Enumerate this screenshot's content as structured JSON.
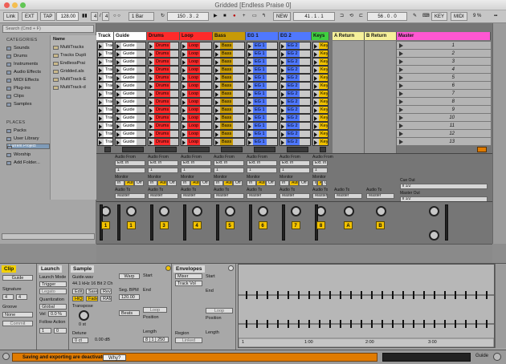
{
  "window": {
    "title": "Gridded  [Endless Praise 0]"
  },
  "control_bar": {
    "link": "Link",
    "ext": "EXT",
    "tap": "TAP",
    "tempo": "128.00",
    "signature_num": "4",
    "signature_den": "4",
    "metronome": "○ ○",
    "quantize": "1 Bar",
    "position": "150 .   3 .   2",
    "new": "NEW",
    "loop_start": "41 .   1 .   1",
    "loop_length": "56 .   0 .   0",
    "key": "KEY",
    "midi": "MIDI",
    "cpu": "9 %"
  },
  "browser": {
    "search_placeholder": "Search (Cmd + F)",
    "categories_header": "CATEGORIES",
    "categories": [
      "Sounds",
      "Drums",
      "Instruments",
      "Audio Effects",
      "MIDI Effects",
      "Plug-ins",
      "Clips",
      "Samples"
    ],
    "places_header": "PLACES",
    "places": [
      "Packs",
      "User Library",
      "Current Project",
      "Worship",
      "Add Folder..."
    ],
    "name_header": "Name",
    "files": [
      "MultiTracks",
      "Tracks Dupli",
      "EndlessPrai",
      "Gridded.als",
      "MultiTrack-E",
      "MultiTrack-d"
    ]
  },
  "tracks": [
    {
      "name": "Track",
      "color": "#ffffff",
      "clip": "Track",
      "clip_color": "#ffffff",
      "number": "1"
    },
    {
      "name": "Guide",
      "color": "#ffffff",
      "clip": "Guide",
      "clip_color": "#ffffff",
      "number": "1"
    },
    {
      "name": "Drums",
      "color": "#ff2a2a",
      "clip": "Drums",
      "clip_color": "#ff2a2a",
      "number": "3"
    },
    {
      "name": "Loop",
      "color": "#ff2a2a",
      "clip": "Loop",
      "clip_color": "#ff2a2a",
      "number": "4"
    },
    {
      "name": "Bass",
      "color": "#c79a06",
      "clip": "Bass",
      "clip_color": "#c79a06",
      "number": "5"
    },
    {
      "name": "EG 1",
      "color": "#4f78ff",
      "clip": "EG 1",
      "clip_color": "#4f78ff",
      "number": "6"
    },
    {
      "name": "EG 2",
      "color": "#4f78ff",
      "clip": "EG 2",
      "clip_color": "#4f78ff",
      "number": "7"
    },
    {
      "name": "Keys",
      "color": "#3fcf3f",
      "clip": "Key",
      "clip_color": "#f0c100",
      "number": "8"
    }
  ],
  "returns": [
    {
      "name": "A Return",
      "color": "#f6f09a",
      "letter": "A"
    },
    {
      "name": "B Return",
      "color": "#f6f09a",
      "letter": "B"
    }
  ],
  "master": {
    "name": "Master",
    "color": "#ff57d2",
    "scenes": [
      "1",
      "2",
      "3",
      "4",
      "5",
      "6",
      "7",
      "8",
      "9",
      "10",
      "11",
      "12",
      "13"
    ],
    "cue_out_label": "Cue Out",
    "cue_out": "ii 1/2",
    "master_out_label": "Master Out",
    "master_out": "ii 1/2"
  },
  "io": {
    "audio_from": "Audio From",
    "ext_in": "Ext. In",
    "in_1": "1",
    "monitor": "Monitor",
    "in": "In",
    "auto": "Auto",
    "off": "Off",
    "audio_to": "Audio To",
    "master": "Master"
  },
  "detail": {
    "clip": {
      "title": "Clip",
      "name": "Guide",
      "signature_label": "Signature",
      "sig_num": "4",
      "sig_den": "4",
      "groove_label": "Groove",
      "groove": "None",
      "commit": "Commit"
    },
    "launch": {
      "title": "Launch",
      "mode_label": "Launch Mode",
      "mode": "Trigger",
      "legato": "Legato",
      "quant_label": "Quantization",
      "quant": "Global",
      "vel_label": "Vel",
      "vel": "0.0 %",
      "follow_label": "Follow Action",
      "f1": "1",
      "f2": "0"
    },
    "sample": {
      "title": "Sample",
      "file": "Guide.wav",
      "info": "44.1 kHz 16 Bit 2 Ch",
      "edit": "Edit",
      "save": "Save",
      "rev": "Rev",
      "hiq": "HiQ",
      "fade": "Fade",
      "ram": "RAM",
      "transpose_label": "Transpose",
      "transpose": "0 st",
      "detune_label": "Detune",
      "detune": "0 ct",
      "gain": "0.00 dB",
      "warp": "Warp",
      "start": "Start",
      "end": "End",
      "seg_bpm_label": "Seg. BPM",
      "seg_bpm": "120.00",
      "mode": "Beats",
      "loop": "Loop",
      "position_label": "Position",
      "length_label": "Length",
      "length_vals": "8 | 1 | 250"
    },
    "envelopes": {
      "title": "Envelopes",
      "device": "Mixer",
      "control": "Track Vol",
      "start": "Start",
      "end": "End",
      "loop": "Loop",
      "position": "Position",
      "length": "Length",
      "region": "Region",
      "linked": "Linked"
    },
    "ruler": [
      "1",
      "1:00",
      "2:00",
      "3:00"
    ]
  },
  "status": {
    "message": "Saving and exporting are deactivated.",
    "why": "Why?",
    "track": "Guide"
  }
}
